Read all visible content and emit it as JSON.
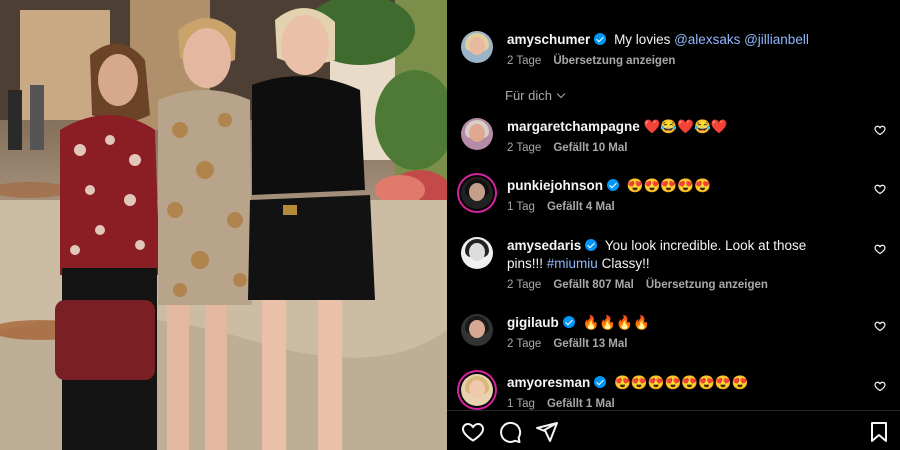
{
  "post": {
    "username": "amyschumer",
    "caption": "My lovies",
    "mentions": [
      "@alexsaks",
      "@jillianbell"
    ],
    "time": "2 Tage",
    "translate": "Übersetzung anzeigen"
  },
  "filter": {
    "label": "Für dich"
  },
  "comments": [
    {
      "username": "margaretchampagne",
      "verified": false,
      "text": "❤️😂❤️😂❤️",
      "time": "2 Tage",
      "likes": "Gefällt 10 Mal",
      "translate": ""
    },
    {
      "username": "punkiejohnson",
      "verified": true,
      "text": "😍😍😍😍😍",
      "time": "1 Tag",
      "likes": "Gefällt 4 Mal",
      "translate": ""
    },
    {
      "username": "amysedaris",
      "verified": true,
      "text": "You look incredible. Look at those pins!!!",
      "hashtag": "#miumiu",
      "text2": "Classy!!",
      "time": "2 Tage",
      "likes": "Gefällt 807 Mal",
      "translate": "Übersetzung anzeigen"
    },
    {
      "username": "gigilaub",
      "verified": true,
      "text": "🔥🔥🔥🔥",
      "time": "2 Tage",
      "likes": "Gefällt 13 Mal",
      "translate": ""
    },
    {
      "username": "amyoresman",
      "verified": true,
      "text": "😍😍😍😍😍😍😍😍",
      "time": "1 Tag",
      "likes": "Gefällt 1 Mal",
      "translate": ""
    }
  ],
  "actions": [
    "heart-icon",
    "comment-icon",
    "share-icon",
    "bookmark-icon"
  ],
  "colors": {
    "background": "#000000",
    "text": "#f5f5f5",
    "muted": "#a8a8a8",
    "link": "#8fb8ff",
    "verified": "#0095f6"
  }
}
